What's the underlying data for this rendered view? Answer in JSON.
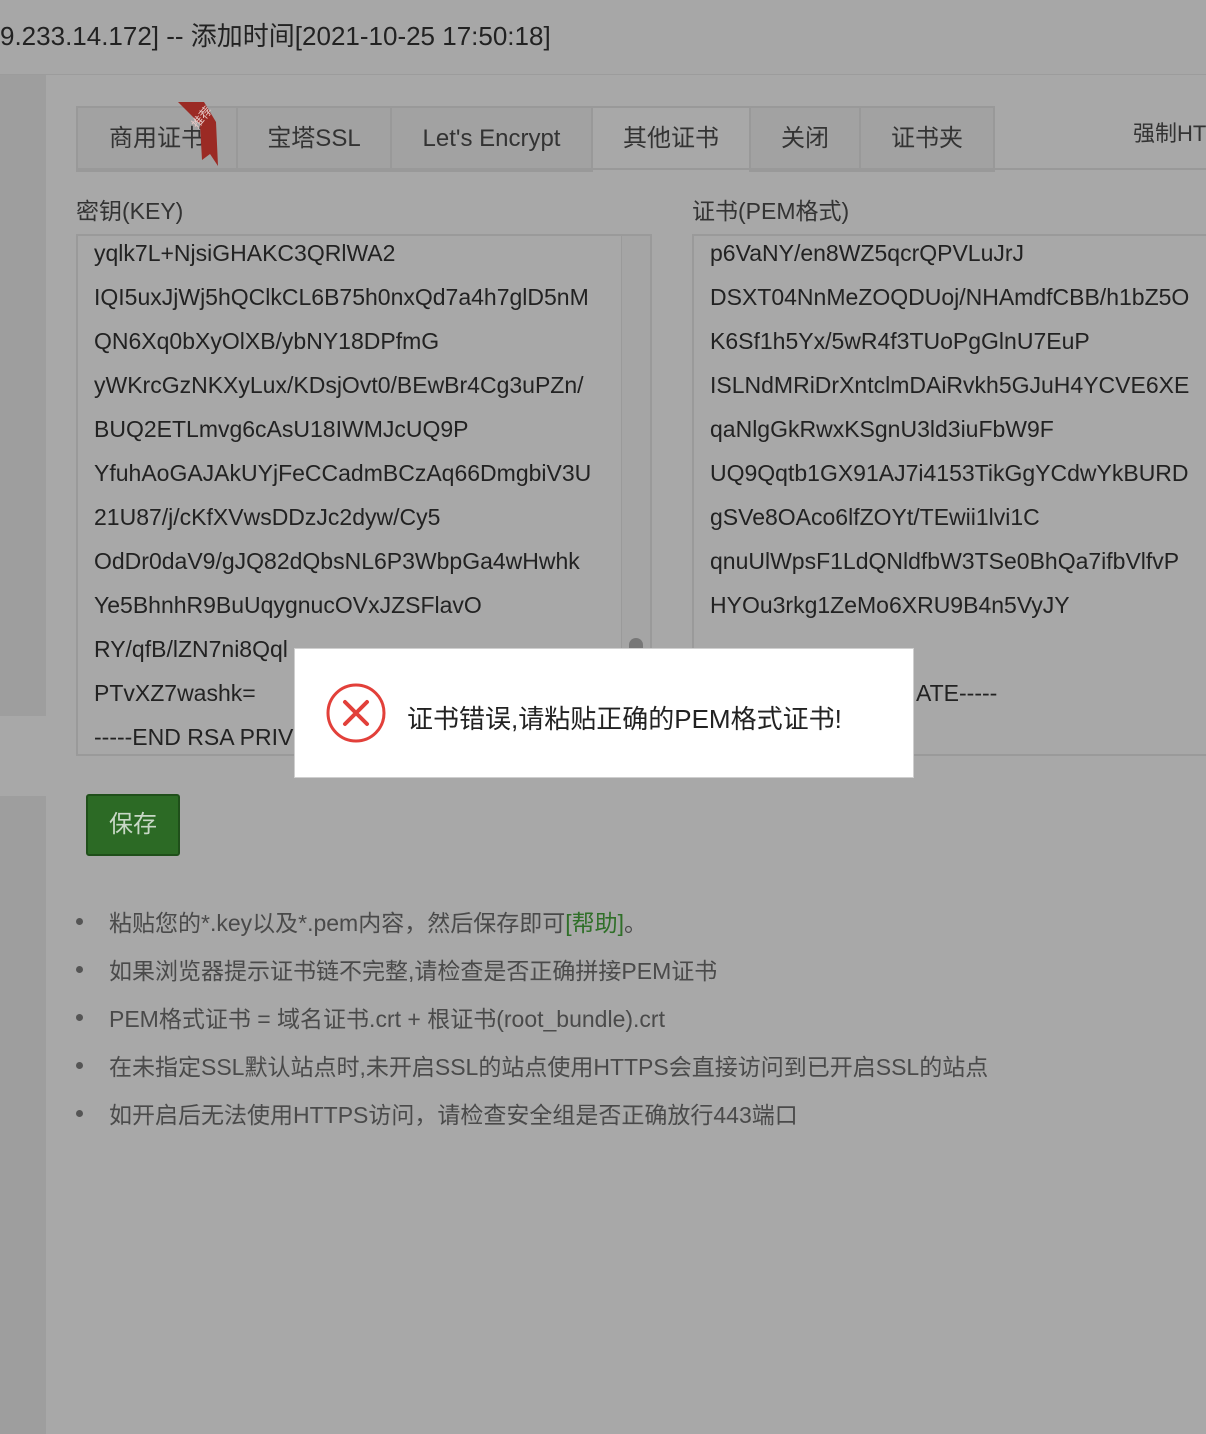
{
  "titlebar": {
    "title": "9.233.14.172] -- 添加时间[2021-10-25 17:50:18]"
  },
  "tabs": [
    {
      "label": "商用证书",
      "ribbon": "推荐"
    },
    {
      "label": "宝塔SSL"
    },
    {
      "label": "Let's Encrypt"
    },
    {
      "label": "其他证书",
      "active": true
    },
    {
      "label": "关闭"
    },
    {
      "label": "证书夹"
    }
  ],
  "force_https_label": "强制HT",
  "key_field": {
    "label": "密钥(KEY)",
    "lines": [
      "yqlk7L+NjsiGHAKC3QRlWA2",
      "IQI5uxJjWj5hQClkCL6B75h0nxQd7a4h7glD5nM",
      "QN6Xq0bXyOlXB/ybNY18DPfmG",
      "yWKrcGzNKXyLux/KDsjOvt0/BEwBr4Cg3uPZn/",
      "BUQ2ETLmvg6cAsU18IWMJcUQ9P",
      "YfuhAoGAJAkUYjFeCCadmBCzAq66DmgbiV3U",
      "21U87/j/cKfXVwsDDzJc2dyw/Cy5",
      "OdDr0daV9/gJQ82dQbsNL6P3WbpGa4wHwhk",
      "Ye5BhnhR9BuUqygnucOVxJZSFlavO",
      "RY/qfB/lZN7ni8Qql",
      "PTvXZ7washk=",
      "-----END RSA PRIV"
    ]
  },
  "cert_field": {
    "label": "证书(PEM格式)",
    "lines": [
      "p6VaNY/en8WZ5qcrQPVLuJrJ",
      "DSXT04NnMeZOQDUoj/NHAmdfCBB/h1bZ5O",
      "K6Sf1h5Yx/5wR4f3TUoPgGlnU7EuP",
      "ISLNdMRiDrXntclmDAiRvkh5GJuH4YCVE6XE",
      "qaNlgGkRwxKSgnU3ld3iuFbW9F",
      "UQ9Qqtb1GX91AJ7i4153TikGgYCdwYkBURD",
      "gSVe8OAco6lfZOYt/TEwii1lvi1C",
      "qnuUlWpsF1LdQNldfbW3TSe0BhQa7ifbVlfvP",
      "HYOu3rkg1ZeMo6XRU9B4n5VyJY",
      "",
      "ATE-----"
    ]
  },
  "save_button": {
    "label": "保存"
  },
  "tips": [
    {
      "text": "粘贴您的*.key以及*.pem内容，然后保存即可",
      "link": "[帮助]",
      "suffix": "。"
    },
    {
      "text": "如果浏览器提示证书链不完整,请检查是否正确拼接PEM证书"
    },
    {
      "text": "PEM格式证书 = 域名证书.crt + 根证书(root_bundle).crt"
    },
    {
      "text": "在未指定SSL默认站点时,未开启SSL的站点使用HTTPS会直接访问到已开启SSL的站点"
    },
    {
      "text": "如开启后无法使用HTTPS访问，请检查安全组是否正确放行443端口"
    }
  ],
  "modal": {
    "message": "证书错误,请粘贴正确的PEM格式证书!",
    "icon": "error-x-icon",
    "icon_color": "#e2403a"
  }
}
